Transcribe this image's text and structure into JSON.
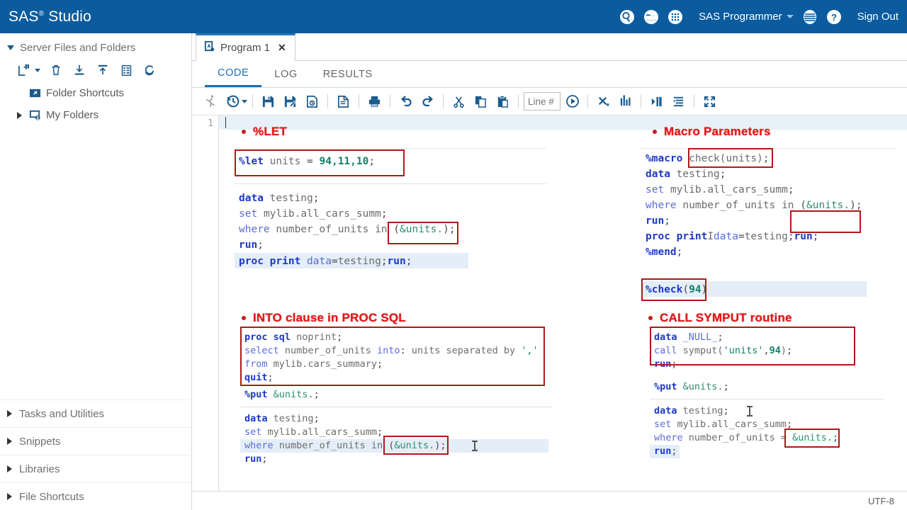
{
  "header": {
    "brand": "SAS",
    "brand_sup": "®",
    "brand_rest": "Studio",
    "icons": [
      "search-icon",
      "folder-icon",
      "keypad-icon"
    ],
    "role": "SAS Programmer",
    "menu_icon": "hamburger-circle-icon",
    "help_icon": "help-icon",
    "signout": "Sign Out",
    "bg_color": "#0a5c9e"
  },
  "sidebar": {
    "title": "Server Files and Folders",
    "toolbar": [
      "new-icon",
      "delete-icon",
      "download-icon",
      "upload-icon",
      "properties-icon",
      "refresh-icon"
    ],
    "tree": [
      {
        "label": "Folder Shortcuts",
        "icon": "folder-shortcut-icon",
        "expandable": false
      },
      {
        "label": "My Folders",
        "icon": "my-folders-icon",
        "expandable": true
      }
    ],
    "sections": [
      {
        "label": "Tasks and Utilities"
      },
      {
        "label": "Snippets"
      },
      {
        "label": "Libraries"
      },
      {
        "label": "File Shortcuts"
      }
    ]
  },
  "editor": {
    "program_tab": "Program 1",
    "close_label": "✕",
    "subtabs": [
      {
        "label": "CODE",
        "active": true
      },
      {
        "label": "LOG",
        "active": false
      },
      {
        "label": "RESULTS",
        "active": false
      }
    ],
    "toolbar_icons": [
      "run-icon",
      "history-icon",
      "save-icon",
      "save-as-icon",
      "save-version-icon",
      "new-program-icon",
      "print-icon",
      "undo-icon",
      "redo-icon",
      "cut-icon",
      "copy-icon",
      "paste-icon"
    ],
    "line_placeholder": "Line #",
    "toolbar_icons_right": [
      "goto-line-icon",
      "clear-all-icon",
      "compare-icon",
      "indent-icon",
      "format-code-icon",
      "maximize-icon"
    ],
    "line_numbers": [
      "1"
    ],
    "status": "UTF-8"
  },
  "annotations": [
    {
      "id": "let",
      "text": "%LET"
    },
    {
      "id": "into",
      "text": "INTO clause in PROC SQL"
    },
    {
      "id": "macro-params",
      "text": "Macro Parameters"
    },
    {
      "id": "call-symput",
      "text": "CALL SYMPUT routine"
    }
  ],
  "code": {
    "left": {
      "let_block": "%let units = 94,11,10;",
      "block1": [
        "data testing;",
        "set mylib.all_cars_summ;",
        "where number_of_units in (&units.);",
        "run;",
        "proc print data=testing;run;"
      ],
      "sql_block": [
        "proc sql noprint;",
        "select number_of_units into: units separated by ','",
        "from mylib.cars_summary;",
        "quit;"
      ],
      "put_line": "%put &units.;",
      "block2": [
        "data testing;",
        "set mylib.all_cars_summ;",
        "where number_of_units in (&units.);",
        "run;"
      ]
    },
    "right": {
      "macro_block": [
        "%macro check(units);",
        "data testing;",
        "set mylib.all_cars_summ;",
        "where number_of_units in (&units.);",
        "run;",
        "proc print data=testing;run;",
        "%mend;",
        "%check(94)"
      ],
      "symput_block": [
        "data _NULL_;",
        "call symput('units',94);",
        "run;"
      ],
      "put_line": "%put &units.;",
      "block2": [
        "data testing;",
        "set mylib.all_cars_summ;",
        "where number_of_units = &units.;",
        "run;"
      ]
    }
  },
  "colors": {
    "header_blue": "#0a5c9e",
    "accent_blue": "#1c6fb5",
    "annotation_red": "#e01b1b",
    "box_red": "#b01818",
    "keyword_blue": "#1d39c4",
    "number_green": "#12806a",
    "highlight": "#e4eef8"
  }
}
